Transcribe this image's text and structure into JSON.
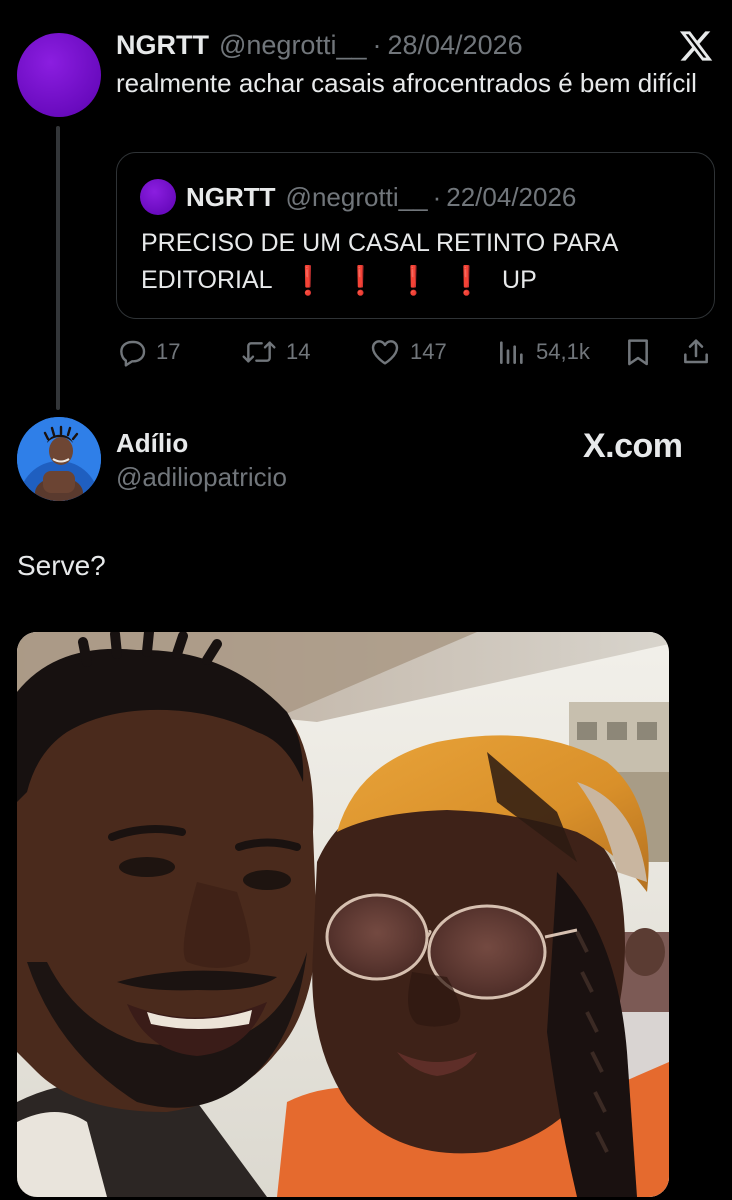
{
  "quoting_tweet": {
    "name": "NGRTT",
    "handle": "@negrotti__",
    "separator": "·",
    "date": "28/04/2026",
    "text": "realmente achar casais afrocentrados é bem difícil",
    "brand_icon": "x-logo-icon",
    "avatar_color": "#7b12d1",
    "quoted_tweet": {
      "name": "NGRTT",
      "handle": "@negrotti__",
      "separator": "·",
      "date": "22/04/2026",
      "line1": "PRECISO DE UM CASAL RETINTO PARA",
      "line2": "EDITORIAL",
      "exclamations": [
        "❗",
        "❗",
        "❗",
        "❗"
      ],
      "line2_end": "UP"
    },
    "actions": {
      "replies": "17",
      "reposts": "14",
      "likes": "147",
      "views": "54,1k"
    }
  },
  "reply_tweet": {
    "name": "Adílio",
    "handle": "@adiliopatricio",
    "watermark": "X.com",
    "text": "Serve?",
    "avatar_bg": "#2b78e4",
    "photo_alt": "Selfie of a smiling man and a woman wearing an orange head wrap and round sunglasses"
  },
  "colors": {
    "background": "#000000",
    "text": "#e7e9ea",
    "muted": "#71767b",
    "border": "#2f3336",
    "accent_red": "#e0112b"
  }
}
